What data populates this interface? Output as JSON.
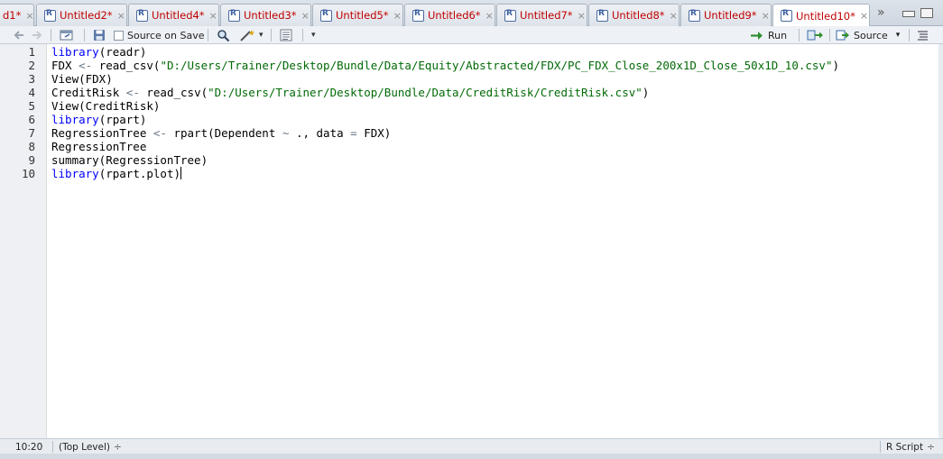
{
  "tabs": [
    {
      "label": "d1*",
      "close": "×"
    },
    {
      "label": "Untitled2*",
      "close": "×"
    },
    {
      "label": "Untitled4*",
      "close": "×"
    },
    {
      "label": "Untitled3*",
      "close": "×"
    },
    {
      "label": "Untitled5*",
      "close": "×"
    },
    {
      "label": "Untitled6*",
      "close": "×"
    },
    {
      "label": "Untitled7*",
      "close": "×"
    },
    {
      "label": "Untitled8*",
      "close": "×"
    },
    {
      "label": "Untitled9*",
      "close": "×"
    },
    {
      "label": "Untitled10*",
      "close": "×"
    }
  ],
  "tab_overflow": "»",
  "toolbar": {
    "source_on_save": "Source on Save",
    "run": "Run",
    "source": "Source",
    "dropdown_arrow": "▾"
  },
  "editor": {
    "line_numbers": [
      "1",
      "2",
      "3",
      "4",
      "5",
      "6",
      "7",
      "8",
      "9",
      "10"
    ],
    "lines": [
      [
        {
          "t": "library",
          "c": "kw"
        },
        {
          "t": "(readr)",
          "c": ""
        }
      ],
      [
        {
          "t": "FDX ",
          "c": ""
        },
        {
          "t": "<-",
          "c": "op"
        },
        {
          "t": " read_csv(",
          "c": ""
        },
        {
          "t": "\"D:/Users/Trainer/Desktop/Bundle/Data/Equity/Abstracted/FDX/PC_FDX_Close_200x1D_Close_50x1D_10.csv\"",
          "c": "str"
        },
        {
          "t": ")",
          "c": ""
        }
      ],
      [
        {
          "t": "View(FDX)",
          "c": ""
        }
      ],
      [
        {
          "t": "CreditRisk ",
          "c": ""
        },
        {
          "t": "<-",
          "c": "op"
        },
        {
          "t": " read_csv(",
          "c": ""
        },
        {
          "t": "\"D:/Users/Trainer/Desktop/Bundle/Data/CreditRisk/CreditRisk.csv\"",
          "c": "str"
        },
        {
          "t": ")",
          "c": ""
        }
      ],
      [
        {
          "t": "View(CreditRisk)",
          "c": ""
        }
      ],
      [
        {
          "t": "library",
          "c": "kw"
        },
        {
          "t": "(rpart)",
          "c": ""
        }
      ],
      [
        {
          "t": "RegressionTree ",
          "c": ""
        },
        {
          "t": "<-",
          "c": "op"
        },
        {
          "t": " rpart(Dependent ",
          "c": ""
        },
        {
          "t": "~",
          "c": "op"
        },
        {
          "t": " ., data ",
          "c": ""
        },
        {
          "t": "=",
          "c": "op"
        },
        {
          "t": " FDX)",
          "c": ""
        }
      ],
      [
        {
          "t": "RegressionTree",
          "c": ""
        }
      ],
      [
        {
          "t": "summary(RegressionTree)",
          "c": ""
        }
      ],
      [
        {
          "t": "library",
          "c": "kw"
        },
        {
          "t": "(rpart.plot)",
          "c": ""
        }
      ]
    ]
  },
  "status": {
    "position": "10:20",
    "scope": "(Top Level)",
    "scope_arrow": "÷",
    "file_type": "R Script",
    "file_type_arrow": "÷"
  }
}
